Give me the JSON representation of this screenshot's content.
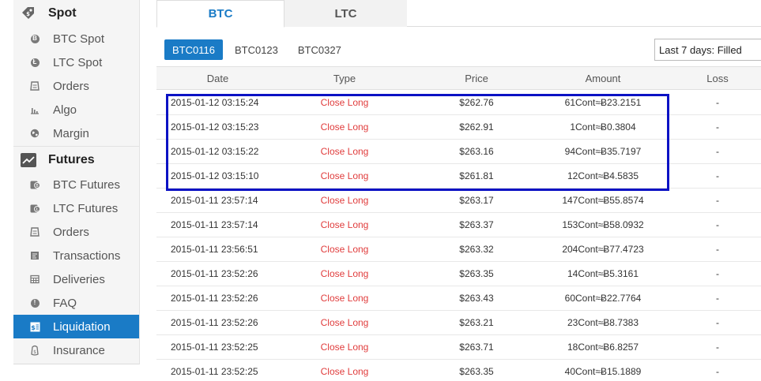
{
  "sidebar": {
    "spot": {
      "title": "Spot",
      "items": [
        {
          "label": "BTC Spot",
          "icon": "btc-coin-icon"
        },
        {
          "label": "LTC Spot",
          "icon": "ltc-coin-icon"
        },
        {
          "label": "Orders",
          "icon": "orders-icon"
        },
        {
          "label": "Algo",
          "icon": "algo-chart-icon"
        },
        {
          "label": "Margin",
          "icon": "globe-icon"
        }
      ]
    },
    "futures": {
      "title": "Futures",
      "items": [
        {
          "label": "BTC Futures",
          "icon": "btc-futures-icon"
        },
        {
          "label": "LTC Futures",
          "icon": "ltc-futures-icon"
        },
        {
          "label": "Orders",
          "icon": "orders-icon"
        },
        {
          "label": "Transactions",
          "icon": "transactions-icon"
        },
        {
          "label": "Deliveries",
          "icon": "deliveries-icon"
        },
        {
          "label": "FAQ",
          "icon": "faq-icon"
        },
        {
          "label": "Liquidation",
          "icon": "liquidation-icon",
          "active": true
        },
        {
          "label": "Insurance",
          "icon": "insurance-icon"
        }
      ]
    }
  },
  "tabs": [
    {
      "label": "BTC",
      "active": true
    },
    {
      "label": "LTC",
      "active": false
    }
  ],
  "contracts": [
    {
      "label": "BTC0116",
      "active": true
    },
    {
      "label": "BTC0123",
      "active": false
    },
    {
      "label": "BTC0327",
      "active": false
    }
  ],
  "filter": {
    "selected": "Last 7 days: Filled"
  },
  "table": {
    "columns": [
      "Date",
      "Type",
      "Price",
      "Amount",
      "Loss"
    ],
    "rows": [
      {
        "date": "2015-01-12 03:15:24",
        "type": "Close Long",
        "price": "$262.76",
        "amount": "61Cont≈Ƀ23.2151",
        "loss": "-"
      },
      {
        "date": "2015-01-12 03:15:23",
        "type": "Close Long",
        "price": "$262.91",
        "amount": "1Cont≈Ƀ0.3804",
        "loss": "-"
      },
      {
        "date": "2015-01-12 03:15:22",
        "type": "Close Long",
        "price": "$263.16",
        "amount": "94Cont≈Ƀ35.7197",
        "loss": "-"
      },
      {
        "date": "2015-01-12 03:15:10",
        "type": "Close Long",
        "price": "$261.81",
        "amount": "12Cont≈Ƀ4.5835",
        "loss": "-"
      },
      {
        "date": "2015-01-11 23:57:14",
        "type": "Close Long",
        "price": "$263.17",
        "amount": "147Cont≈Ƀ55.8574",
        "loss": "-"
      },
      {
        "date": "2015-01-11 23:57:14",
        "type": "Close Long",
        "price": "$263.37",
        "amount": "153Cont≈Ƀ58.0932",
        "loss": "-"
      },
      {
        "date": "2015-01-11 23:56:51",
        "type": "Close Long",
        "price": "$263.32",
        "amount": "204Cont≈Ƀ77.4723",
        "loss": "-"
      },
      {
        "date": "2015-01-11 23:52:26",
        "type": "Close Long",
        "price": "$263.35",
        "amount": "14Cont≈Ƀ5.3161",
        "loss": "-"
      },
      {
        "date": "2015-01-11 23:52:26",
        "type": "Close Long",
        "price": "$263.43",
        "amount": "60Cont≈Ƀ22.7764",
        "loss": "-"
      },
      {
        "date": "2015-01-11 23:52:26",
        "type": "Close Long",
        "price": "$263.21",
        "amount": "23Cont≈Ƀ8.7383",
        "loss": "-"
      },
      {
        "date": "2015-01-11 23:52:25",
        "type": "Close Long",
        "price": "$263.71",
        "amount": "18Cont≈Ƀ6.8257",
        "loss": "-"
      },
      {
        "date": "2015-01-11 23:52:25",
        "type": "Close Long",
        "price": "$263.35",
        "amount": "40Cont≈Ƀ15.1889",
        "loss": "-"
      }
    ]
  },
  "colors": {
    "accent": "#1a7bc6",
    "type_text": "#e03c3c",
    "highlight_box": "#0b12c4"
  }
}
